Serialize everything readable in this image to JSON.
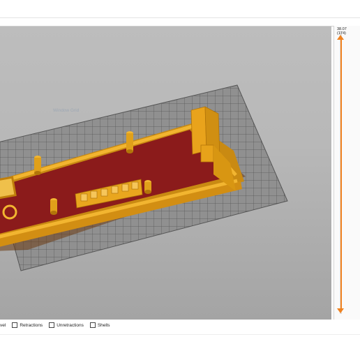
{
  "viewport": {
    "watermark": "Window Grid",
    "background_color": "#b9b9b9",
    "bed_color": "#8d8d8d",
    "bed_grid_color": "#5a5a5a",
    "part_wall_color": "#f0a81a",
    "part_floor_color": "#8b1a1a"
  },
  "layer_slider": {
    "top_value": "38.07",
    "top_layer": "(174)",
    "bottom_value": "0.",
    "bottom_layer": "(1",
    "accent_color": "#f0821f",
    "settings_icon": "gear-icon"
  },
  "legend": {
    "items": [
      {
        "label": "vel",
        "checked": false
      },
      {
        "label": "Retractions",
        "checked": false
      },
      {
        "label": "Unretractions",
        "checked": false
      },
      {
        "label": "Shells",
        "checked": false
      }
    ]
  }
}
